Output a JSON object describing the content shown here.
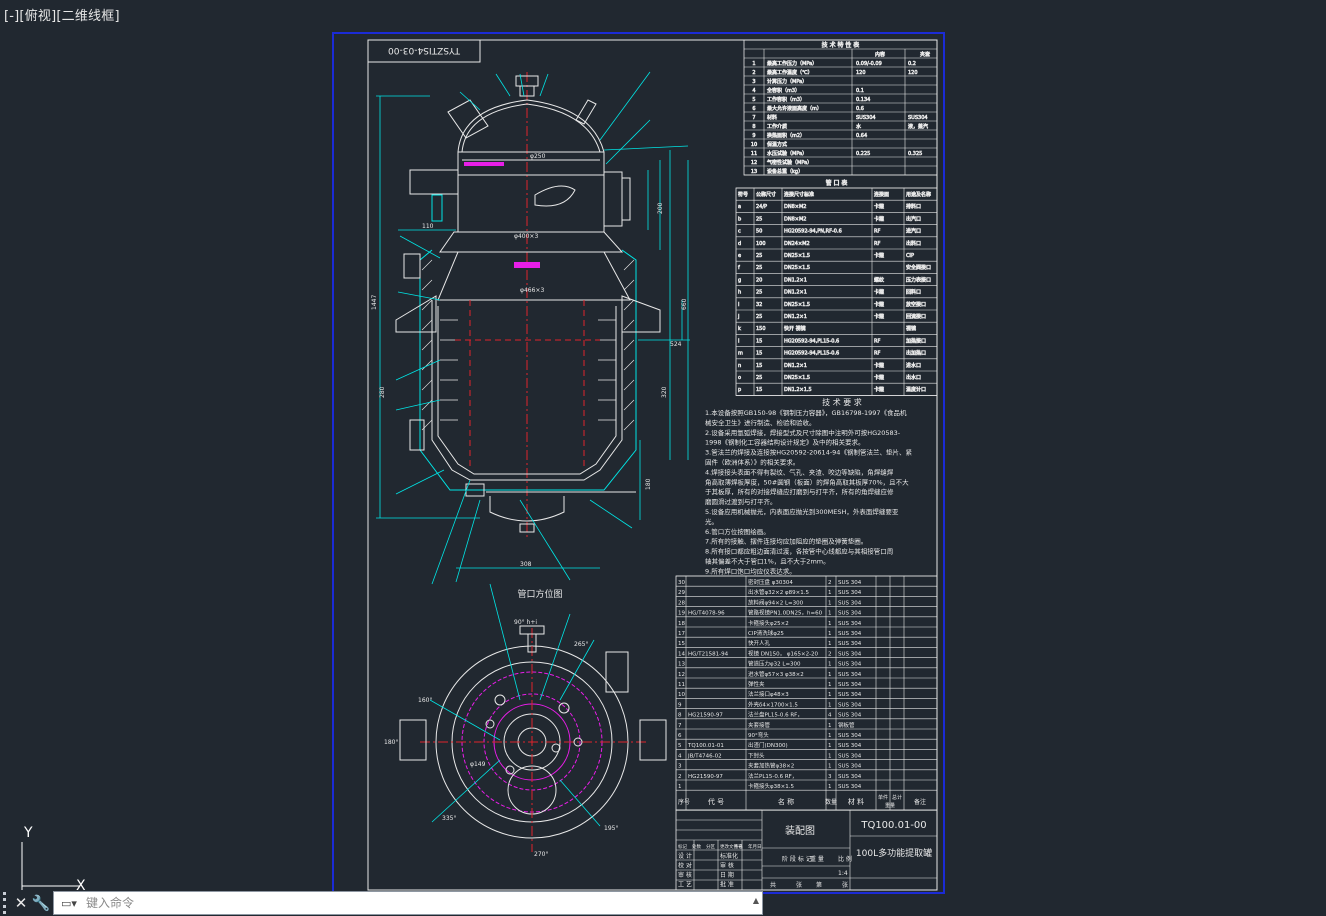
{
  "viewport": {
    "label": "[-][俯视][二维线框]"
  },
  "drawing": {
    "drawing_number_rotated": "TYSZTIS4-03-00",
    "section_label": "管口方位图",
    "tech_spec": {
      "title": "技 术 特 性 表",
      "col_in": "内容",
      "col_jacket": "夹套",
      "rows": [
        {
          "name": "最高工作压力（MPa）",
          "in": "0.09/-0.09",
          "jk": "0.2"
        },
        {
          "name": "最高工作温度（℃）",
          "in": "120",
          "jk": "120"
        },
        {
          "name": "计算压力（MPa）",
          "in": "",
          "jk": ""
        },
        {
          "name": "全容积（m3）",
          "in": "0.1",
          "jk": ""
        },
        {
          "name": "工作容积（m3）",
          "in": "0.134",
          "jk": ""
        },
        {
          "name": "最大允许液面高度（m）",
          "in": "0.6",
          "jk": ""
        },
        {
          "name": "材料",
          "in": "SUS304",
          "jk": "SUS304"
        },
        {
          "name": "工作介质",
          "in": "水",
          "jk": "液，蒸汽"
        },
        {
          "name": "换热面积（m2）",
          "in": "0.64",
          "jk": ""
        },
        {
          "name": "保温方式",
          "in": "",
          "jk": ""
        },
        {
          "name": "水压试验（MPa）",
          "in": "0.225",
          "jk": "0.325"
        },
        {
          "name": "气密性试验（MPa）",
          "in": "",
          "jk": ""
        },
        {
          "name": "设备总重（kg）",
          "in": "",
          "jk": ""
        }
      ]
    },
    "nozzle_table": {
      "title": "管 口 表",
      "headers": [
        "符号",
        "公称尺寸",
        "连接尺寸标准",
        "连接面",
        "用途及名称"
      ],
      "rows": [
        [
          "a",
          "24/P",
          "DN8×M2",
          "卡箍",
          "排料口"
        ],
        [
          "b",
          "25",
          "DN8×M2",
          "卡箍",
          "出汽口"
        ],
        [
          "c",
          "50",
          "HG20592-94,PN,RF-0.6",
          "RF",
          "进汽口"
        ],
        [
          "d",
          "100",
          "DN24×M2",
          "RF",
          "出料口"
        ],
        [
          "e",
          "25",
          "DN25×1.5",
          "卡箍",
          "CIP"
        ],
        [
          "f",
          "25",
          "DN25×1.5",
          "",
          "安全阀接口"
        ],
        [
          "g",
          "20",
          "DN1.2×1",
          "螺纹",
          "压力表接口"
        ],
        [
          "h",
          "25",
          "DN1.2×1",
          "卡箍",
          "回料口"
        ],
        [
          "i",
          "32",
          "DN25×1.5",
          "卡箍",
          "放空接口"
        ],
        [
          "j",
          "25",
          "DN1.2×1",
          "卡箍",
          "回流接口"
        ],
        [
          "k",
          "150",
          "快开 视镜",
          "",
          "视镜"
        ],
        [
          "l",
          "15",
          "HG20592-94,PL15-0.6",
          "RF",
          "加热接口"
        ],
        [
          "m",
          "15",
          "HG20592-94,PL15-0.6",
          "RF",
          "出加热口"
        ],
        [
          "n",
          "15",
          "DN1.2×1",
          "卡箍",
          "进水口"
        ],
        [
          "o",
          "25",
          "DN25×1.5",
          "卡箍",
          "出水口"
        ],
        [
          "p",
          "15",
          "DN1.2×1.5",
          "卡箍",
          "温度计口"
        ]
      ]
    },
    "tech_req": {
      "title": "技 术 要 求",
      "lines": [
        "1.本设备按照GB150-98《钢制压力容器》，GB16798-1997《食品机",
        "械安全卫生》进行制造、检验和验收。",
        "2.设备采用氩弧焊接，焊接型式及尺寸除图中注明外可按HG20583-",
        "1998《钢制化工容器结构设计规定》及中的相关要求。",
        "3.管法兰的焊接及连接按HG20592-20614-94《钢制管法兰、垫片、紧",
        "固件（欧洲体系）》的相关要求。",
        "4.焊接接头表面不得有裂纹、气孔、夹渣、咬边等缺陷，角焊缝焊",
        "角高取薄焊板厚度，50#圆钢（板面）的焊角高取其板厚70%，且不大",
        "于其板厚，所有的对接焊缝应打磨到与打平齐，所有的角焊缝应修",
        "磨圆滑过渡到与打平齐。",
        "5.设备应用机械抛光，内表面应抛光到300MESH，外表面焊缝要亚",
        "光。",
        "6.管口方位按图绘画。",
        "7.所有的接触、摆件连接均应加阻应的垫圈及弹簧垫圈。",
        "8.所有接口都应粗边面清过渡，各按管中心线都应与其相接管口周",
        "轴其偏差不大于管口1%，且不大于2mm。",
        "9.所有焊口饱口均应仪表达求。"
      ]
    },
    "bom": {
      "rows": [
        [
          "30",
          "",
          "密封压盘 φ30304",
          "2",
          "SUS 304"
        ],
        [
          "29",
          "",
          "出水管φ32×2 φ89×1.5",
          "1",
          "SUS 304"
        ],
        [
          "28",
          "",
          "放料阀φ94×2 L=300",
          "1",
          "SUS 304"
        ],
        [
          "19",
          "HG/T4078-96",
          "管路视镜PN1.0DN25，h=60",
          "1",
          "SUS 304"
        ],
        [
          "18",
          "",
          "卡箍接头φ25×2",
          "1",
          "SUS 304"
        ],
        [
          "17",
          "",
          "CIP清洗球φ25",
          "1",
          "SUS 304"
        ],
        [
          "15",
          "",
          "快开人孔",
          "1",
          "SUS 304"
        ],
        [
          "14",
          "HG/T21581-94",
          "视镜 DN150， φ165×2-20",
          "2",
          "SUS 304"
        ],
        [
          "13",
          "",
          "管道压力φ32 L=300",
          "1",
          "SUS 304"
        ],
        [
          "12",
          "",
          "进水管φ57×3 φ38×2",
          "1",
          "SUS 304"
        ],
        [
          "11",
          "",
          "弹性夹",
          "1",
          "SUS 304"
        ],
        [
          "10",
          "",
          "法兰接口φ48×3",
          "1",
          "SUS 304"
        ],
        [
          "9",
          "",
          "外壳δ4×1700×1.5",
          "1",
          "SUS 304"
        ],
        [
          "8",
          "HG21590-97",
          "法兰盘PL15-0.6 RF，",
          "4",
          "SUS 304"
        ],
        [
          "7",
          "",
          "夹套接管",
          "1",
          "钢板管"
        ],
        [
          "6",
          "",
          "90°弯头",
          "1",
          "SUS 304"
        ],
        [
          "5",
          "TQ100.01-01",
          "出渣门(DN300)",
          "1",
          "SUS 304"
        ],
        [
          "4",
          "JB/T4746-02",
          "下封头",
          "1",
          "SUS 304"
        ],
        [
          "3",
          "",
          "夹套加热管φ38×2",
          "1",
          "SUS 304"
        ],
        [
          "2",
          "HG21590-97",
          "法兰PL15-0.6 RF，",
          "3",
          "SUS 304"
        ],
        [
          "1",
          "",
          "卡箍接头φ38×1.5",
          "1",
          "SUS 304"
        ]
      ],
      "header": {
        "no": "序号",
        "code": "代 号",
        "name": "名 称",
        "qty": "数量",
        "mat": "材 料",
        "wt_single": "单件",
        "wt_total": "总计",
        "wt": "重量",
        "note": "备注"
      }
    },
    "title_block": {
      "drawing_name": "装配图",
      "drawing_code": "TQ100.01-00",
      "product_name": "100L多功能提取罐",
      "stage": "阶 段 标 记",
      "weight": "重 量",
      "scale_label": "比 例",
      "scale": "1:4",
      "sheet_total": "共",
      "sheet_label": "张",
      "sheet_no": "第",
      "sheet_label2": "张",
      "roles": [
        "标记",
        "处数",
        "分区",
        "更改文件号",
        "签名",
        "年月日"
      ],
      "people": [
        [
          "设 计",
          "标准化"
        ],
        [
          "校 对",
          "审 核"
        ],
        [
          "审 核",
          "日 期"
        ],
        [
          "工 艺",
          "批 准"
        ]
      ]
    },
    "dims": {
      "d250": "φ250",
      "d400": "φ400×3",
      "d466": "φ466×3",
      "h200": "200",
      "h160": "160",
      "h1447": "1447",
      "h660": "660",
      "h320": "320",
      "h280": "280",
      "h180": "180",
      "h120": "120",
      "h90": "90",
      "w308": "308",
      "w110": "110",
      "w524": "524",
      "d149": "φ149",
      "a90": "90° h+i",
      "a265": "265°",
      "a160": "160°",
      "a180": "180°",
      "a335": "335°",
      "a270": "270°",
      "a195": "195°"
    }
  },
  "ucs": {
    "y_label": "Y",
    "x_label": "X"
  },
  "command_line": {
    "placeholder": "键入命令"
  }
}
